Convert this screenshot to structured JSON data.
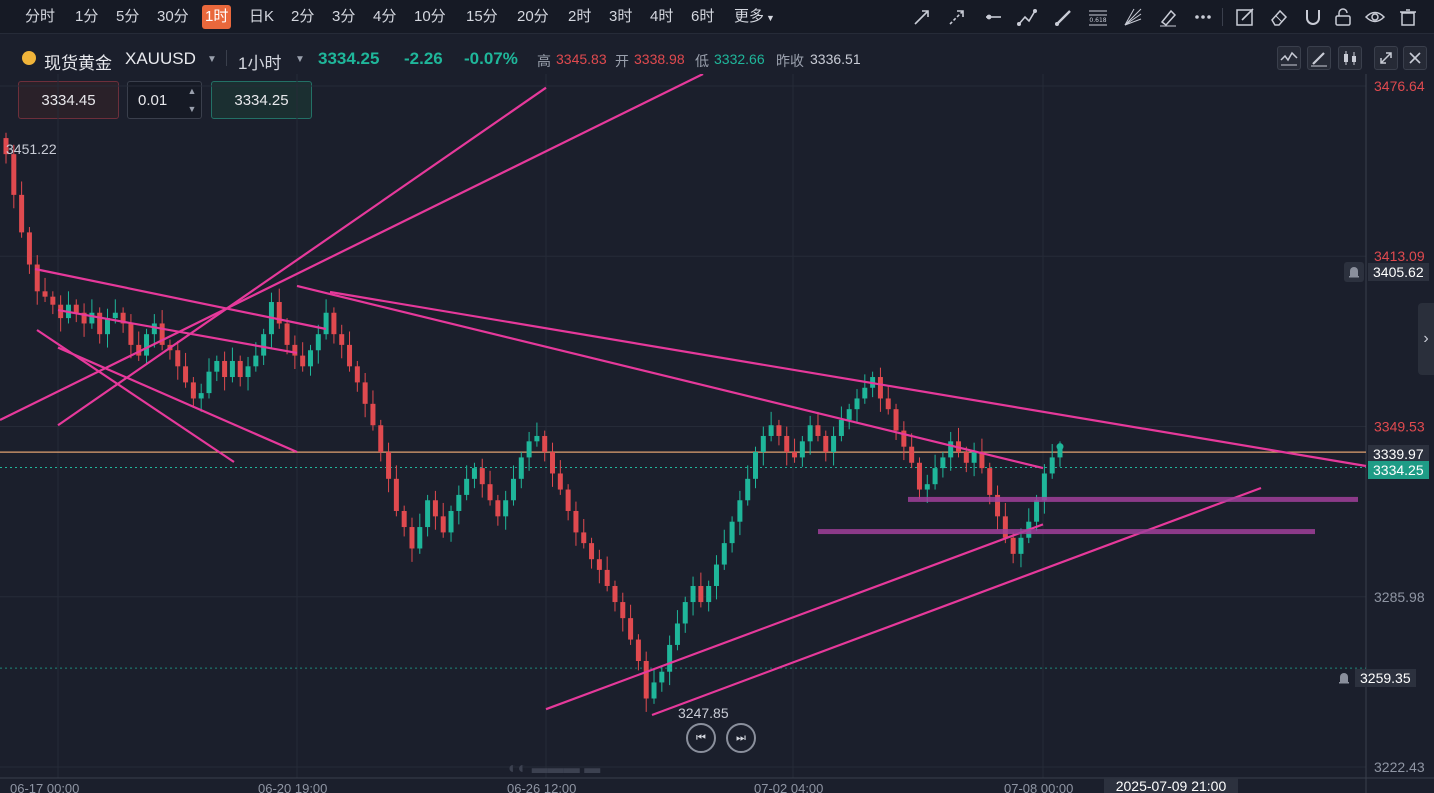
{
  "toolbar": {
    "timeframes": [
      "分时",
      "1分",
      "5分",
      "30分",
      "1时",
      "日K",
      "2分",
      "3分",
      "4分",
      "10分",
      "15分",
      "20分",
      "2时",
      "3时",
      "4时",
      "6时",
      "更多"
    ],
    "active": "1时",
    "drawing_tools": [
      "arrow-line-icon",
      "dashed-arrow-icon",
      "horizontal-line-icon",
      "polyline-icon",
      "brush-icon",
      "fibonacci-icon",
      "fan-icon",
      "highlighter-icon",
      "more-dots-icon",
      "edit-icon",
      "eraser-icon",
      "magnet-icon",
      "lock-icon",
      "eye-icon",
      "trash-icon"
    ]
  },
  "header": {
    "name": "现货黄金",
    "symbol": "XAUUSD",
    "interval": "1小时",
    "price": "3334.25",
    "change": "-2.26",
    "change_pct": "-0.07%",
    "high_label": "高",
    "high": "3345.83",
    "open_label": "开",
    "open": "3338.98",
    "low_label": "低",
    "low": "3332.66",
    "prev_label": "昨收",
    "prev": "3336.51"
  },
  "order": {
    "sell_price": "3334.45",
    "qty": "0.01",
    "buy_price": "3334.25"
  },
  "axis_tags": {
    "current": "3334.25",
    "line_level": "3339.97",
    "alert_1": "3405.62",
    "alert_2": "3259.35"
  },
  "date_badge": "2025-07-09 21:00",
  "nav": {
    "prev": "⏮",
    "next": "⏭"
  },
  "side_tab": "›",
  "colors": {
    "up": "#1fb69a",
    "down": "#e04a4f",
    "trendline": "#e6399b",
    "zone": "#a0409a",
    "level_line": "#e0a070",
    "bg": "#1b1f2c"
  },
  "chart_data": {
    "type": "candlestick",
    "y_ticks": [
      "3476.64",
      "3413.09",
      "3349.53",
      "3285.98",
      "3222.43"
    ],
    "ylim": [
      3222.43,
      3476.64
    ],
    "x_ticks": [
      "06-17 00:00",
      "06-20 19:00",
      "06-26 12:00",
      "07-02 04:00",
      "07-08 00:00"
    ],
    "swing_labels": {
      "high": "3451.22",
      "low": "3247.85"
    },
    "path": [
      3451.2,
      3436,
      3422,
      3410,
      3400,
      3398,
      3395,
      3390,
      3395,
      3392,
      3388,
      3392,
      3384,
      3390,
      3392,
      3388,
      3380,
      3376,
      3384,
      3388,
      3380,
      3378,
      3372,
      3366,
      3360,
      3362,
      3370,
      3374,
      3368,
      3374,
      3368,
      3372,
      3376,
      3384,
      3396,
      3388,
      3380,
      3376,
      3372,
      3378,
      3384,
      3392,
      3384,
      3380,
      3372,
      3366,
      3358,
      3350,
      3340,
      3330,
      3318,
      3312,
      3304,
      3312,
      3322,
      3316,
      3310,
      3318,
      3324,
      3330,
      3334,
      3328,
      3322,
      3316,
      3322,
      3330,
      3338,
      3344,
      3346,
      3340,
      3332,
      3326,
      3318,
      3310,
      3306,
      3300,
      3296,
      3290,
      3284,
      3278,
      3270,
      3262,
      3248,
      3254,
      3258,
      3268,
      3276,
      3284,
      3290,
      3284,
      3290,
      3298,
      3306,
      3314,
      3322,
      3330,
      3340,
      3346,
      3350,
      3346,
      3340,
      3338,
      3344,
      3350,
      3346,
      3340,
      3346,
      3352,
      3356,
      3360,
      3364,
      3368,
      3360,
      3356,
      3348,
      3342,
      3336,
      3326,
      3328,
      3334,
      3338,
      3344,
      3340,
      3336,
      3340,
      3334,
      3324,
      3316,
      3308,
      3302,
      3308,
      3314,
      3322,
      3332,
      3338,
      3342
    ],
    "trendlines": [
      {
        "from": [
          "06-17 00:00",
          3393
        ],
        "to": [
          "06-20 19:00",
          3377
        ]
      },
      {
        "from": [
          "06-17 00:00",
          3379
        ],
        "to": [
          "06-20 19:00",
          3340
        ]
      },
      {
        "from": [
          "06-17 00:00",
          3350
        ],
        "to": [
          "06-26 12:00",
          3476
        ]
      },
      {
        "from": [
          "06-20 19:00",
          3402
        ],
        "to": [
          "07-08 00:00",
          3334
        ]
      },
      {
        "from": [
          "06-26 12:00",
          3244
        ],
        "to": [
          "07-08 00:00",
          3313
        ]
      }
    ],
    "horizontal_levels": [
      3339.97,
      3334.25,
      3259.35
    ],
    "zones": [
      3322.5,
      3310.5
    ]
  }
}
